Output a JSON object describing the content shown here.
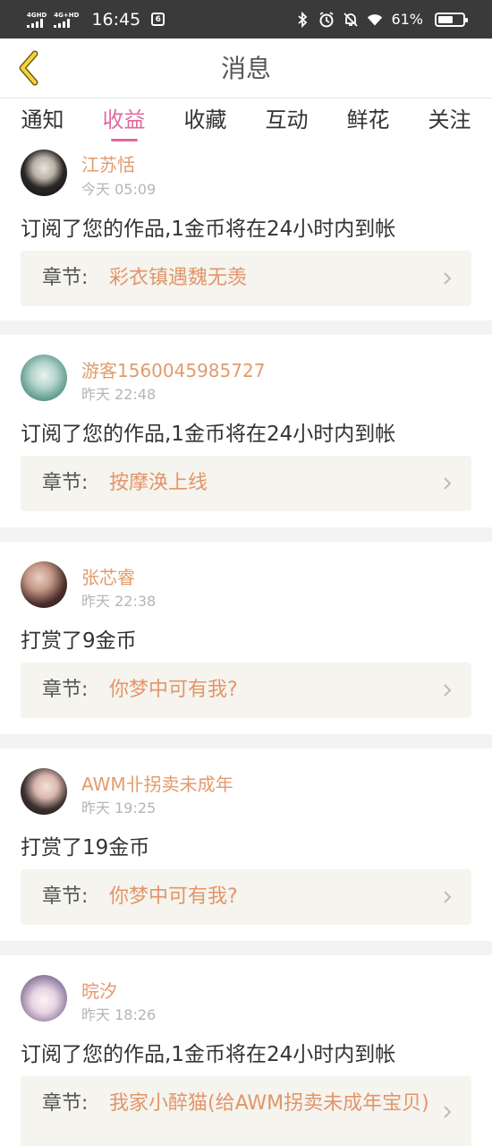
{
  "status_bar": {
    "net1": "4GHD",
    "net2": "4G+HD",
    "time": "16:45",
    "sim_icon": "sim-card-icon",
    "battery": "61%",
    "battery_level": 0.61
  },
  "header": {
    "title": "消息",
    "back_icon": "chevron-left-icon"
  },
  "tabs": [
    {
      "label": "通知",
      "active": false
    },
    {
      "label": "收益",
      "active": true
    },
    {
      "label": "收藏",
      "active": false
    },
    {
      "label": "互动",
      "active": false
    },
    {
      "label": "鲜花",
      "active": false
    },
    {
      "label": "关注",
      "active": false
    }
  ],
  "messages": [
    {
      "user": "江苏恬",
      "time": "今天 05:09",
      "text": "订阅了您的作品,1金币将在24小时内到帐",
      "chapter_label": "章节:",
      "chapter": "彩衣镇遇魏无羡"
    },
    {
      "user": "游客1560045985727",
      "time": "昨天 22:48",
      "text": "订阅了您的作品,1金币将在24小时内到帐",
      "chapter_label": "章节:",
      "chapter": "按摩涣上线"
    },
    {
      "user": "张芯睿",
      "time": "昨天 22:38",
      "text": "打赏了9金币",
      "chapter_label": "章节:",
      "chapter": "你梦中可有我?"
    },
    {
      "user": "AWM卝拐卖未成年",
      "time": "昨天 19:25",
      "text": "打赏了19金币",
      "chapter_label": "章节:",
      "chapter": "你梦中可有我?"
    },
    {
      "user": "晥汐",
      "time": "昨天 18:26",
      "text": "订阅了您的作品,1金币将在24小时内到帐",
      "chapter_label": "章节:",
      "chapter": "我家小醉猫(给AWM拐卖未成年宝贝)"
    }
  ],
  "colors": {
    "accent_pink": "#e16a9b",
    "name_orange": "#e29b6e",
    "chapter_orange": "#e2956a",
    "chapter_bg": "#f5f4ee",
    "status_bg": "#3a3a3a",
    "back_yellow": "#f5d33b"
  }
}
